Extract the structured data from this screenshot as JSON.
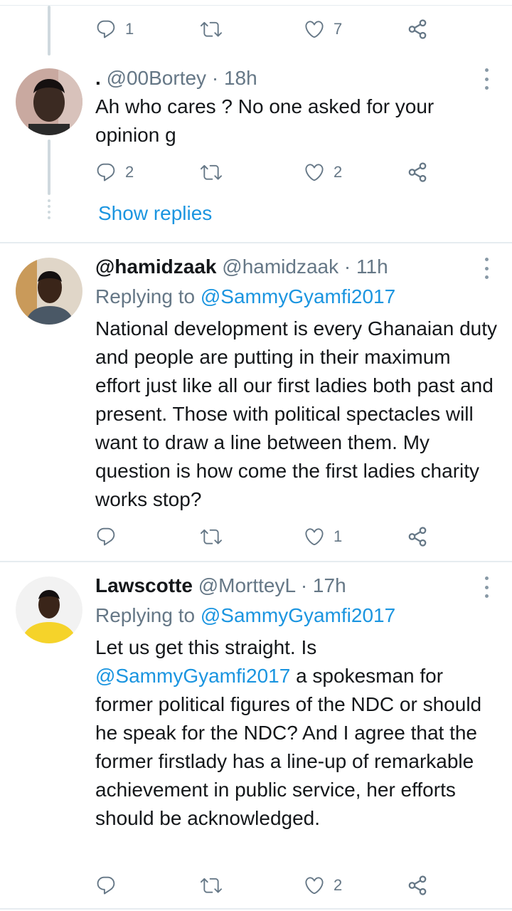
{
  "colors": {
    "accent": "#1b95e0",
    "muted": "#657786",
    "text": "#14171a",
    "divider": "#e6ecf0",
    "thread_line": "#cfd9de"
  },
  "top_actions": {
    "reply_count": "1",
    "retweet_count": "",
    "like_count": "7"
  },
  "tweets": [
    {
      "display_name": ".",
      "handle": "@00Bortey",
      "separator": "·",
      "time": "18h",
      "text": "Ah who cares ? No one asked for your opinion g",
      "reply_count": "2",
      "retweet_count": "",
      "like_count": "2",
      "avatar_icon": "avatar-photo"
    },
    {
      "display_name": "@hamidzaak",
      "handle": "@hamidzaak",
      "separator": "·",
      "time": "11h",
      "replying_prefix": "Replying to",
      "replying_to": "@SammyGyamfi2017",
      "text": "National development is every Ghanaian duty and people are putting in their maximum effort just like all our first ladies both past and present. Those with political spectacles will want to draw a line between them. My question is how come the first ladies charity works stop?",
      "reply_count": "",
      "retweet_count": "",
      "like_count": "1",
      "avatar_icon": "avatar-photo"
    },
    {
      "display_name": "Lawscotte",
      "handle": "@MortteyL",
      "separator": "·",
      "time": "17h",
      "replying_prefix": "Replying to",
      "replying_to": "@SammyGyamfi2017",
      "text_part1": "Let us get this straight. Is",
      "text_mention": "@SammyGyamfi2017",
      "text_part2": " a spokesman for former political figures of the NDC or should he speak for the NDC?  And I agree that the former firstlady has a line-up of remarkable achievement in public service, her efforts should be acknowledged.",
      "reply_count": "",
      "retweet_count": "",
      "like_count": "2",
      "avatar_icon": "avatar-photo"
    }
  ],
  "show_replies_label": "Show replies",
  "icons": {
    "reply": "reply-icon",
    "retweet": "retweet-icon",
    "like": "like-icon",
    "share": "share-icon",
    "more": "more-options-icon"
  }
}
